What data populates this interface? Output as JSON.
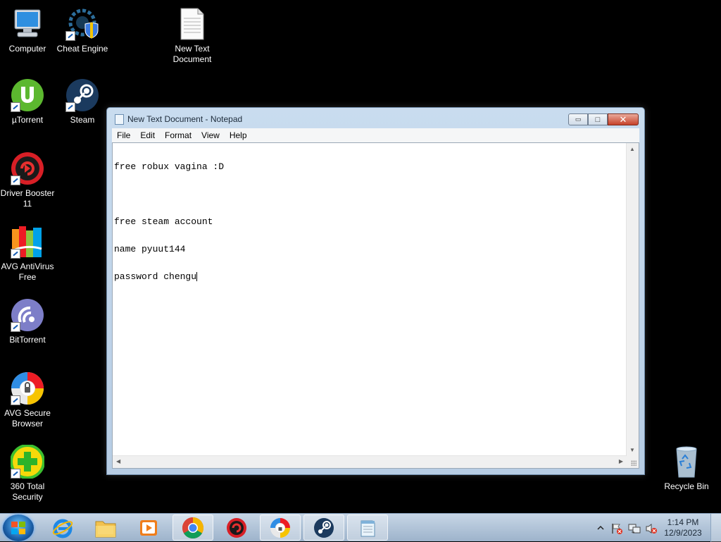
{
  "desktop": {
    "icons": [
      {
        "label": "Computer",
        "icon": "computer-icon"
      },
      {
        "label": "Cheat Engine",
        "icon": "cheat-engine-icon"
      },
      {
        "label": "New Text Document",
        "icon": "text-document-icon"
      },
      {
        "label": "µTorrent",
        "icon": "utorrent-icon"
      },
      {
        "label": "Steam",
        "icon": "steam-icon"
      },
      {
        "label": "Driver Booster 11",
        "icon": "driver-booster-icon"
      },
      {
        "label": "AVG AntiVirus Free",
        "icon": "avg-antivirus-icon"
      },
      {
        "label": "BitTorrent",
        "icon": "bittorrent-icon"
      },
      {
        "label": "AVG Secure Browser",
        "icon": "avg-browser-icon"
      },
      {
        "label": "360 Total Security",
        "icon": "360-security-icon"
      },
      {
        "label": "Recycle Bin",
        "icon": "recycle-bin-icon"
      }
    ]
  },
  "notepad": {
    "title": "New Text Document - Notepad",
    "menu": [
      "File",
      "Edit",
      "Format",
      "View",
      "Help"
    ],
    "lines": [
      "free robux vagina :D",
      "",
      "free steam account",
      "name pyuut144",
      "password chengu"
    ],
    "controls": {
      "minimize": "▭",
      "maximize": "□",
      "close": "✕"
    }
  },
  "taskbar": {
    "items": [
      "start-button",
      "internet-explorer-icon",
      "file-explorer-icon",
      "media-player-icon",
      "chrome-icon",
      "driver-booster-icon",
      "avg-browser-icon",
      "steam-icon",
      "notepad-icon"
    ],
    "time": "1:14 PM",
    "date": "12/9/2023",
    "tray_icons": [
      "show-hidden-icons-arrow",
      "action-center-flag-icon",
      "network-icon",
      "volume-muted-icon"
    ]
  }
}
